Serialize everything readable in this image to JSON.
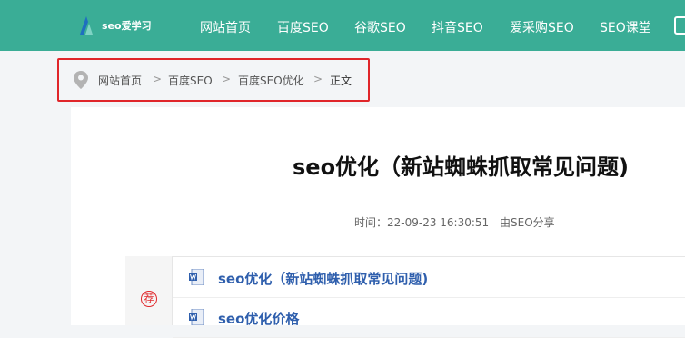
{
  "header": {
    "logo_text": "seo爱学习",
    "nav": [
      "网站首页",
      "百度SEO",
      "谷歌SEO",
      "抖音SEO",
      "爱采购SEO",
      "SEO课堂"
    ]
  },
  "breadcrumb": {
    "items": [
      "网站首页",
      "百度SEO",
      "百度SEO优化",
      "正文"
    ],
    "separator": ">"
  },
  "article": {
    "title": "seo优化（新站蜘蛛抓取常见问题)",
    "time_label": "时间：22-09-23 16:30:51",
    "author_label": "由SEO分享"
  },
  "recommend": {
    "stamp": "荐",
    "items": [
      "seo优化（新站蜘蛛抓取常见问题)",
      "seo优化价格"
    ]
  },
  "colors": {
    "nav_bg": "#3aad96",
    "highlight_border": "#e0262a",
    "link": "#2f5fad"
  }
}
